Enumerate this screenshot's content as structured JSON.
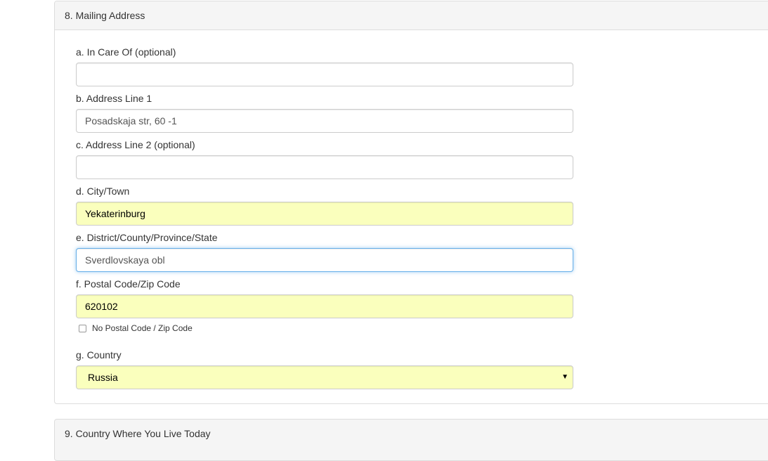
{
  "section": {
    "title": "8. Mailing Address"
  },
  "fields": {
    "in_care_of": {
      "label": "a. In Care Of (optional)",
      "value": ""
    },
    "address_line_1": {
      "label": "b. Address Line 1",
      "value": "Posadskaja str, 60 -1"
    },
    "address_line_2": {
      "label": "c. Address Line 2 (optional)",
      "value": ""
    },
    "city": {
      "label": "d. City/Town",
      "value": "Yekaterinburg"
    },
    "state": {
      "label": "e. District/County/Province/State",
      "value": "Sverdlovskaya obl"
    },
    "postal_code": {
      "label": "f. Postal Code/Zip Code",
      "value": "620102"
    },
    "no_postal_code": {
      "label": "No Postal Code / Zip Code",
      "checked": false
    },
    "country": {
      "label": "g. Country",
      "value": "Russia"
    }
  },
  "next_section": {
    "title": "9. Country Where You Live Today"
  },
  "colors": {
    "autofill": "#faffbd",
    "focus_border": "#66afe9",
    "panel_heading": "#f5f5f5"
  }
}
